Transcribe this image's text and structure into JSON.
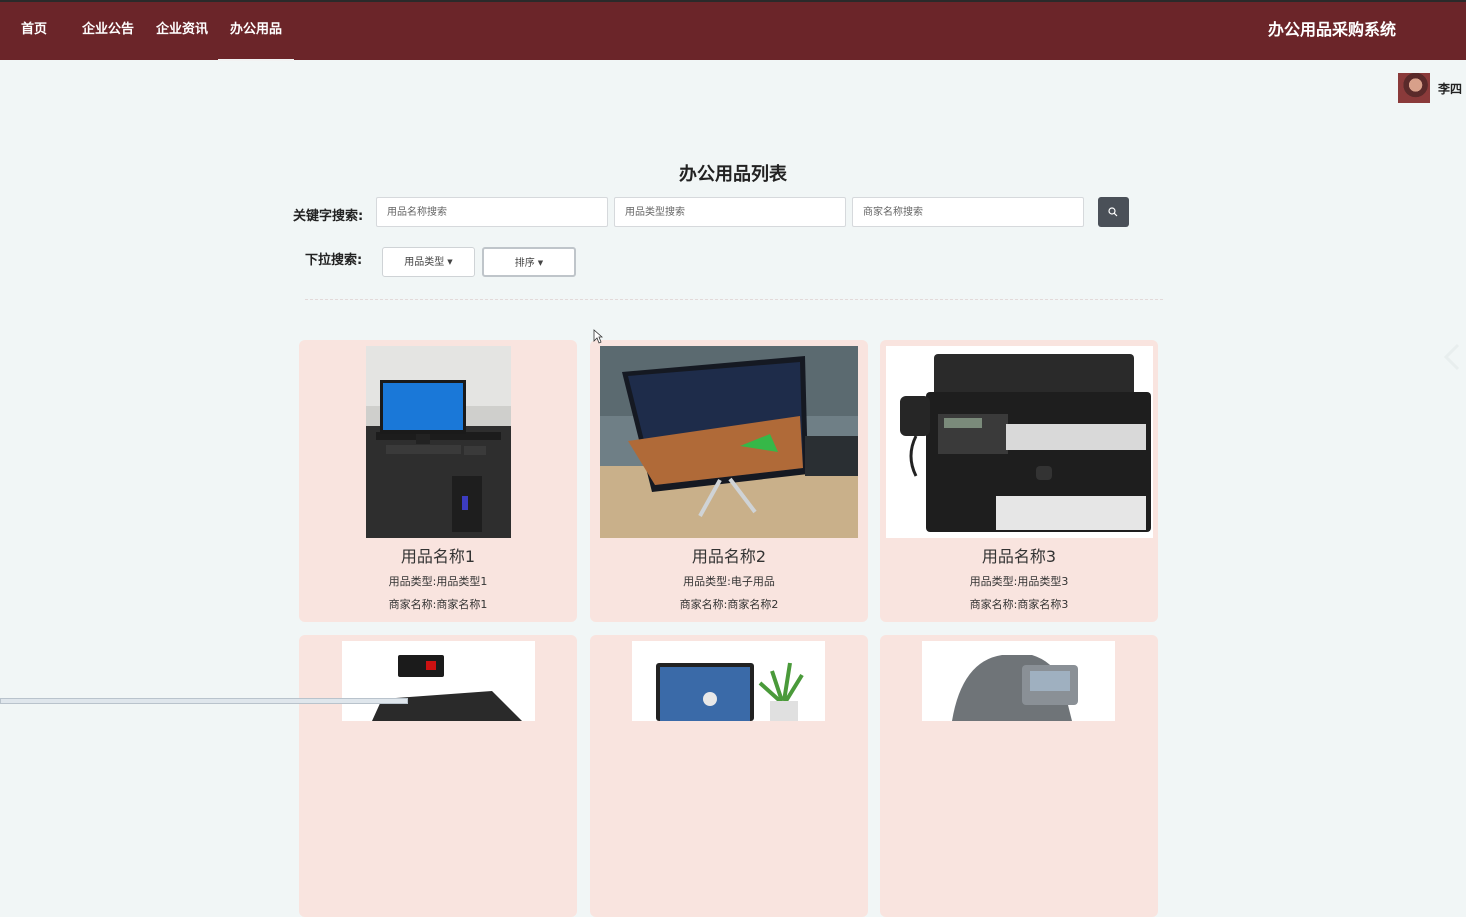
{
  "nav": {
    "items": [
      "首页",
      "企业公告",
      "企业资讯",
      "办公用品"
    ],
    "active_index": 3,
    "brand": "办公用品采购系统"
  },
  "user": {
    "name": "李四"
  },
  "page": {
    "title": "办公用品列表"
  },
  "search": {
    "keyword_label": "关键字搜索:",
    "placeholders": [
      "用品名称搜索",
      "用品类型搜索",
      "商家名称搜索"
    ],
    "dropdown_label": "下拉搜索:",
    "dropdowns": [
      "用品类型",
      "排序"
    ]
  },
  "products": [
    {
      "name": "用品名称1",
      "type": "用品类型:用品类型1",
      "merchant": "商家名称:商家名称1"
    },
    {
      "name": "用品名称2",
      "type": "用品类型:电子用品",
      "merchant": "商家名称:商家名称2"
    },
    {
      "name": "用品名称3",
      "type": "用品类型:用品类型3",
      "merchant": "商家名称:商家名称3"
    }
  ],
  "colors": {
    "navbar": "#6b2529",
    "card": "#f9e4df",
    "background": "#f1f6f6",
    "search_button": "#4a5058"
  }
}
